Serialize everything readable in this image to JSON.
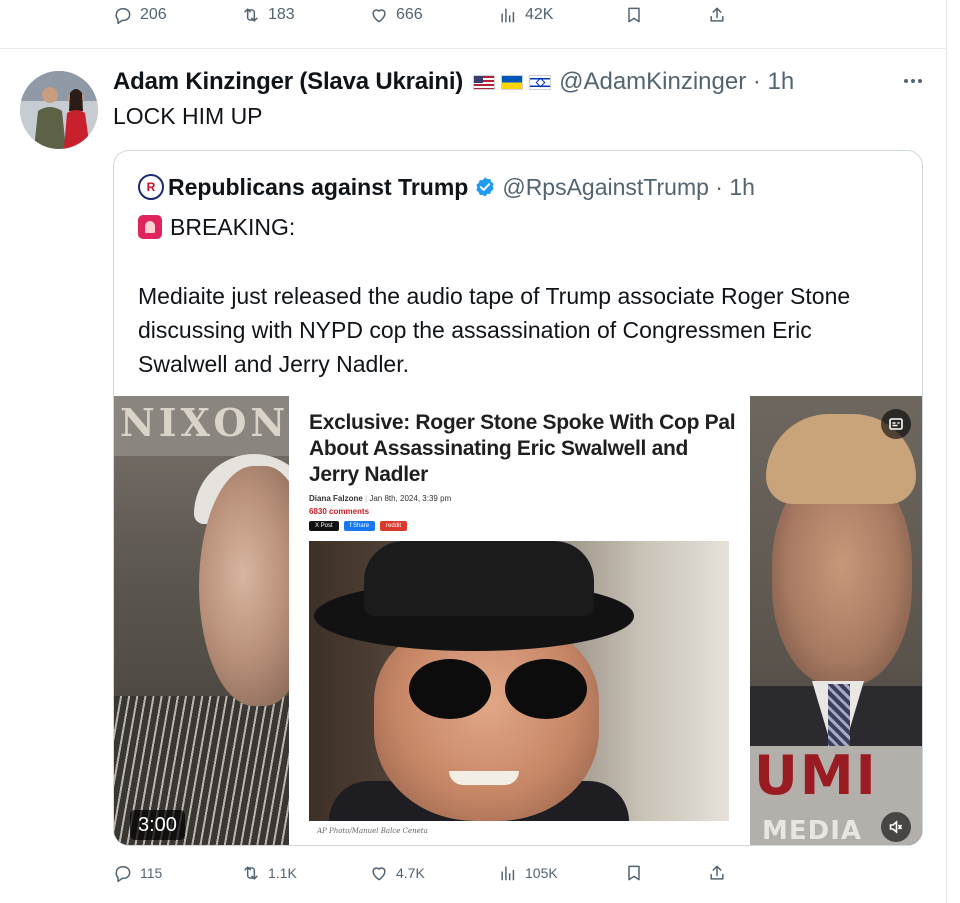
{
  "top_actions": {
    "replies": "206",
    "reposts": "183",
    "likes": "666",
    "views": "42K"
  },
  "tweet": {
    "author_name": "Adam Kinzinger (Slava Ukraini)",
    "flags": [
      "us-flag",
      "ukraine-flag",
      "israel-flag"
    ],
    "handle_time": "@AdamKinzinger · 1h",
    "text": "LOCK HIM UP"
  },
  "quote": {
    "name": "Republicans against Trump",
    "handle_time": "@RpsAgainstTrump · 1h",
    "breaking": "BREAKING:",
    "body": "Mediaite just released the audio tape of Trump associate Roger Stone discussing with NYPD cop the assassination of Congressmen Eric Swalwell and Jerry Nadler."
  },
  "video": {
    "duration": "3:00",
    "left_sign": "NIXON",
    "magazine_letters": "UMI",
    "magazine_word": "MEDIA",
    "article": {
      "title": "Exclusive: Roger Stone Spoke With Cop Pal About Assassinating Eric Swalwell and Jerry Nadler",
      "author": "Diana Falzone",
      "date": "Jan 8th, 2024, 3:39 pm",
      "comments": "6830 comments",
      "share_buttons": [
        "X Post",
        "f Share",
        "reddit"
      ],
      "photo_credit": "AP Photo/Manuel Balce Ceneta"
    }
  },
  "bottom_actions": {
    "replies": "115",
    "reposts": "1.1K",
    "likes": "4.7K",
    "views": "105K"
  },
  "colors": {
    "muted_text": "#536471",
    "border": "#cfd9de",
    "verified_blue": "#1d9bf0",
    "siren_red": "#e0245e"
  }
}
